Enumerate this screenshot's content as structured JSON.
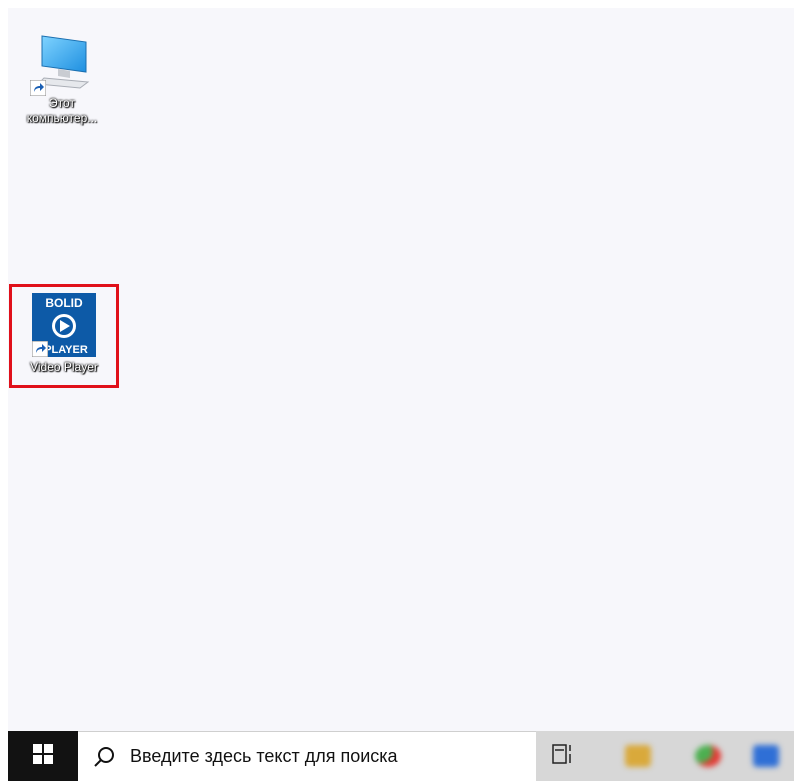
{
  "desktop": {
    "icons": [
      {
        "label": "Этот\nкомпьютер..."
      },
      {
        "label": "Video Player",
        "logo_top": "BOLID",
        "logo_bottom": "PLAYER",
        "selected": true
      }
    ]
  },
  "taskbar": {
    "search_placeholder": "Введите здесь текст для поиска",
    "pinned_apps": [
      {
        "icon": "file-explorer-icon",
        "color": "#d9a93b"
      },
      {
        "icon": "chrome-icon",
        "color": "#4caf50"
      },
      {
        "icon": "app-icon",
        "color": "#2f6fd6"
      }
    ]
  },
  "colors": {
    "selection_outline": "#e0101a",
    "taskbar": "#d7d7d7",
    "start_button": "#121212",
    "bolid_blue": "#0d5aa7"
  }
}
